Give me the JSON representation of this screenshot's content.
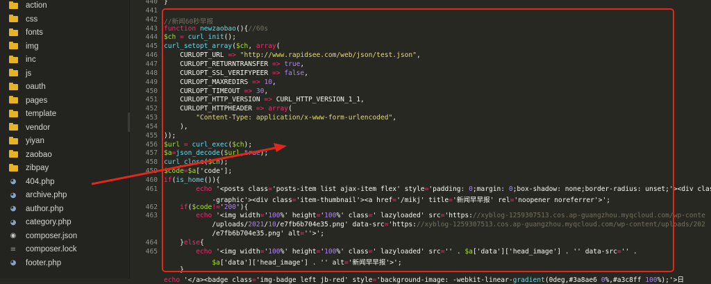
{
  "sidebar": {
    "items": [
      {
        "label": "action",
        "type": "folder"
      },
      {
        "label": "css",
        "type": "folder"
      },
      {
        "label": "fonts",
        "type": "folder"
      },
      {
        "label": "img",
        "type": "folder"
      },
      {
        "label": "inc",
        "type": "folder"
      },
      {
        "label": "js",
        "type": "folder"
      },
      {
        "label": "oauth",
        "type": "folder"
      },
      {
        "label": "pages",
        "type": "folder"
      },
      {
        "label": "template",
        "type": "folder"
      },
      {
        "label": "vendor",
        "type": "folder"
      },
      {
        "label": "yiyan",
        "type": "folder"
      },
      {
        "label": "zaobao",
        "type": "folder"
      },
      {
        "label": "zibpay",
        "type": "folder"
      },
      {
        "label": "404.php",
        "type": "php"
      },
      {
        "label": "archive.php",
        "type": "php"
      },
      {
        "label": "author.php",
        "type": "php"
      },
      {
        "label": "category.php",
        "type": "php"
      },
      {
        "label": "composer.json",
        "type": "json"
      },
      {
        "label": "composer.lock",
        "type": "file"
      },
      {
        "label": "footer.php",
        "type": "php"
      }
    ],
    "collapse_icon": "chevron-left-icon"
  },
  "editor": {
    "lines": [
      {
        "n": "440",
        "text": "}"
      },
      {
        "n": "441",
        "text": ""
      },
      {
        "n": "442",
        "text": "//新闻60秒早报"
      },
      {
        "n": "443",
        "text": "function newzaobao(){//60s"
      },
      {
        "n": "444",
        "text": "$ch = curl_init();"
      },
      {
        "n": "445",
        "text": "curl_setopt_array($ch, array("
      },
      {
        "n": "446",
        "text": "    CURLOPT_URL => \"http://www.rapidsee.com/web/json/test.json\","
      },
      {
        "n": "447",
        "text": "    CURLOPT_RETURNTRANSFER => true,"
      },
      {
        "n": "448",
        "text": "    CURLOPT_SSL_VERIFYPEER => false,"
      },
      {
        "n": "449",
        "text": "    CURLOPT_MAXREDIRS => 10,"
      },
      {
        "n": "450",
        "text": "    CURLOPT_TIMEOUT => 30,"
      },
      {
        "n": "451",
        "text": "    CURLOPT_HTTP_VERSION => CURL_HTTP_VERSION_1_1,"
      },
      {
        "n": "452",
        "text": "    CURLOPT_HTTPHEADER => array("
      },
      {
        "n": "453",
        "text": "        \"Content-Type: application/x-www-form-urlencoded\","
      },
      {
        "n": "454",
        "text": "    ),"
      },
      {
        "n": "455",
        "text": "));"
      },
      {
        "n": "456",
        "text": "$url = curl_exec($ch);"
      },
      {
        "n": "457",
        "text": "$a=json_decode($url,true);"
      },
      {
        "n": "458",
        "text": "curl_close($ch);"
      },
      {
        "n": "459",
        "text": "$code=$a['code'];"
      },
      {
        "n": "460",
        "text": "if(is_home()){"
      },
      {
        "n": "461",
        "text": "        echo '<posts class='posts-item list ajax-item flex' style='padding: 0;margin: 0;box-shadow: none;border-radius: unset;'><div class='"
      },
      {
        "n": "",
        "text": "            -graphic'><div class='item-thumbnail'><a href='/mikj' title='新闻早早报' rel='noopener noreferrer'>';"
      },
      {
        "n": "462",
        "text": "    if($code!='200'){"
      },
      {
        "n": "463",
        "text": "        echo '<img width='100%' height='100%' class=' lazyloaded' src='https://xyblog-1259307513.cos.ap-guangzhou.myqcloud.com/wp-conte"
      },
      {
        "n": "",
        "text": "            /uploads/2021/10/e7fb6b704e35.png' data-src='https://xyblog-1259307513.cos.ap-guangzhou.myqcloud.com/wp-content/uploads/202"
      },
      {
        "n": "",
        "text": "            /e7fb6b704e35.png' alt=''>';"
      },
      {
        "n": "464",
        "text": "    }else{"
      },
      {
        "n": "465",
        "text": "        echo '<img width='100%' height='100%' class=' lazyloaded' src='' . $a['data']['head_image'] . '' data-src='' ."
      },
      {
        "n": "",
        "text": "            $a['data']['head_image'] . '' alt='新闻早早报'>';"
      },
      {
        "n": "",
        "text": "    }"
      },
      {
        "n": "",
        "text": "echo '</a><badge class='img-badge left jb-red' style='background-image: -webkit-linear-gradient(0deg,#3a8ae6 0%,#a3c8ff 100%);'>日"
      }
    ]
  },
  "annotation": {
    "box_color": "#e2281c",
    "arrow_color": "#e2281c"
  }
}
